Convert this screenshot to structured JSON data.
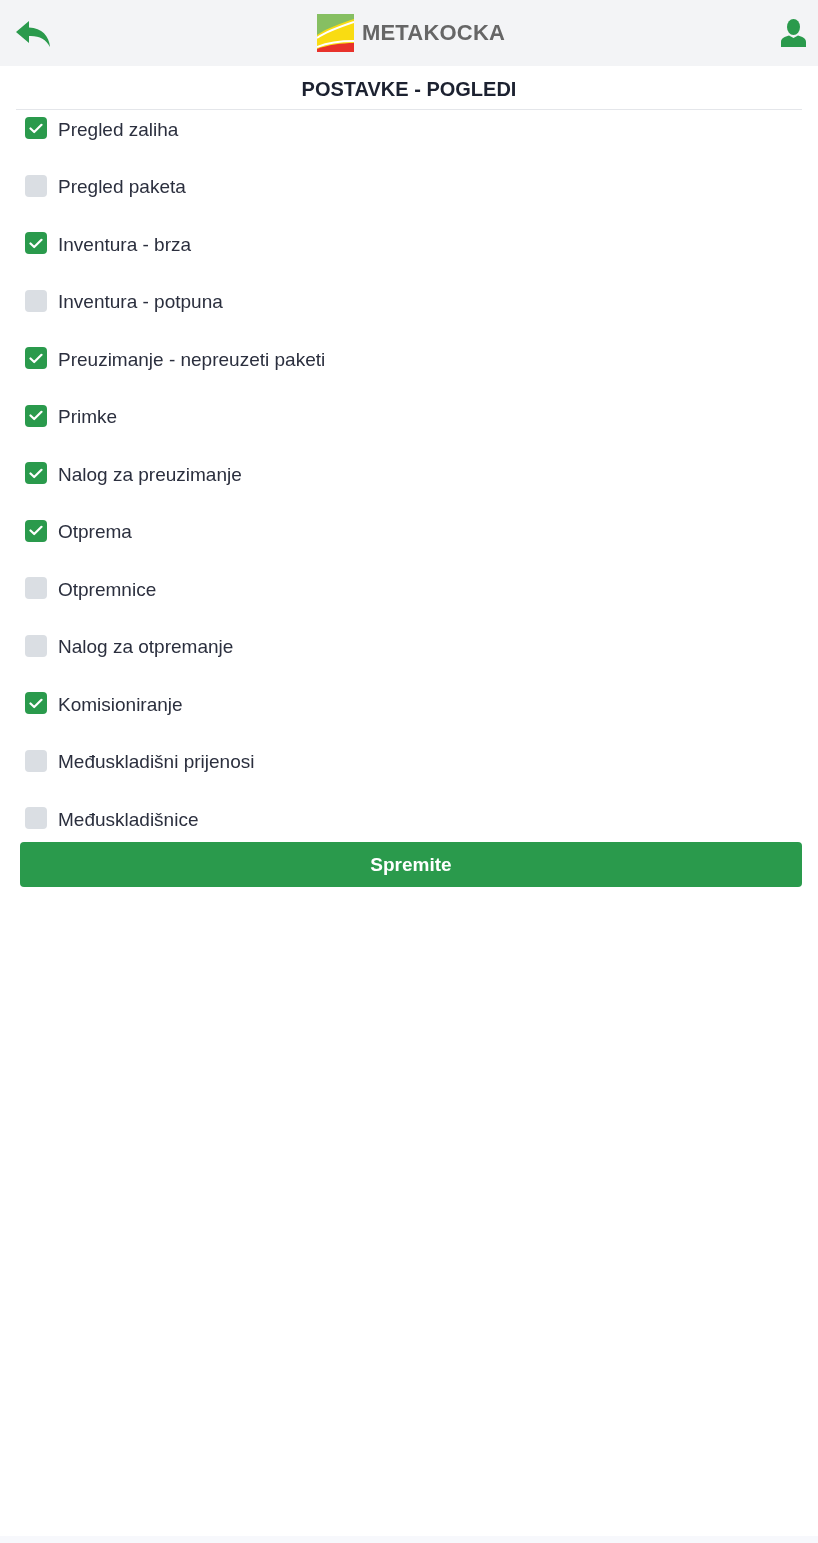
{
  "header": {
    "logo_text": "METAKOCKA"
  },
  "title": "POSTAVKE - POGLEDI",
  "options": [
    {
      "label": "Pregled zaliha",
      "checked": true
    },
    {
      "label": "Pregled paketa",
      "checked": false
    },
    {
      "label": "Inventura - brza",
      "checked": true
    },
    {
      "label": "Inventura - potpuna",
      "checked": false
    },
    {
      "label": "Preuzimanje - nepreuzeti paketi",
      "checked": true
    },
    {
      "label": "Primke",
      "checked": true
    },
    {
      "label": "Nalog za preuzimanje",
      "checked": true
    },
    {
      "label": "Otprema",
      "checked": true
    },
    {
      "label": "Otpremnice",
      "checked": false
    },
    {
      "label": "Nalog za otpremanje",
      "checked": false
    },
    {
      "label": "Komisioniranje",
      "checked": true
    },
    {
      "label": "Međuskladišni prijenosi",
      "checked": false
    },
    {
      "label": "Međuskladišnice",
      "checked": false
    }
  ],
  "save_button": {
    "label": "Spremite"
  }
}
